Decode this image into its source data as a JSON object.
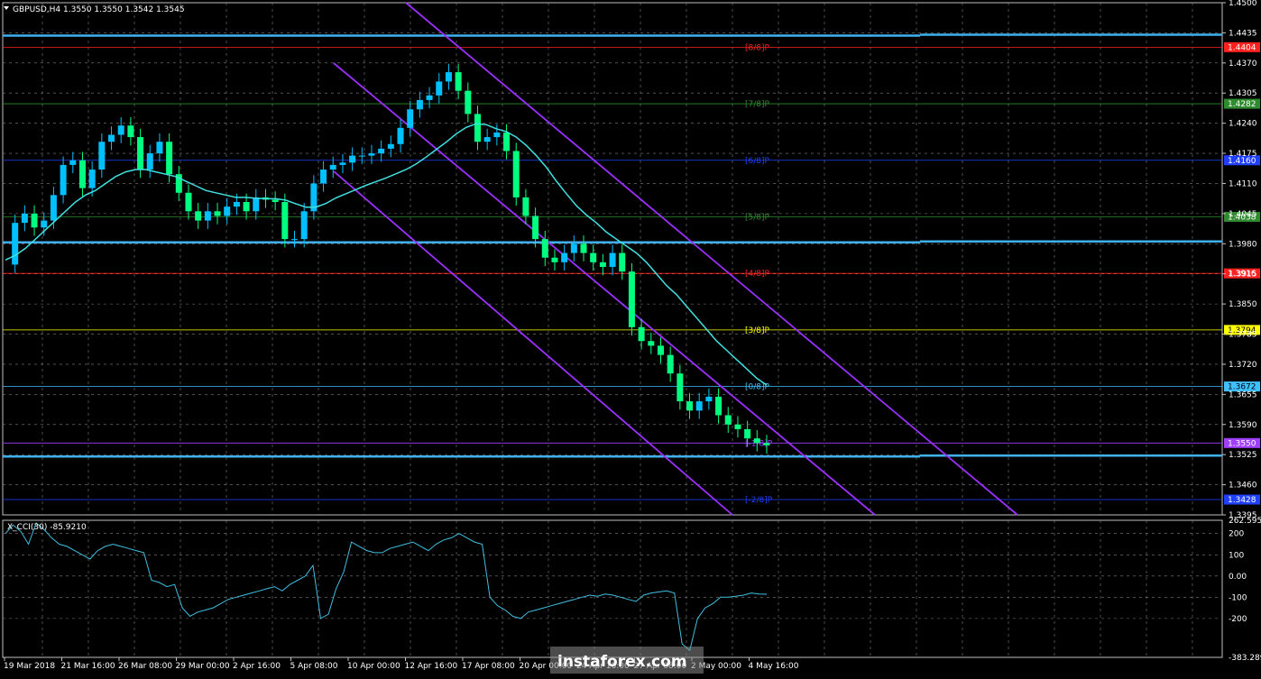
{
  "chart_data": {
    "type": "candlestick",
    "symbol_header": "GBPUSD,H4  1.3550 1.3550 1.3542 1.3545",
    "price_axis": {
      "min": 1.3395,
      "max": 1.45,
      "tick_labels": [
        "1.4500",
        "1.4435",
        "1.4370",
        "1.4305",
        "1.4240",
        "1.4175",
        "1.4110",
        "1.4045",
        "1.3980",
        "1.3915",
        "1.3850",
        "1.3785",
        "1.3720",
        "1.3655",
        "1.3590",
        "1.3525",
        "1.3460",
        "1.3395"
      ]
    },
    "time_axis": {
      "labels": [
        "19 Mar 2018",
        "21 Mar 16:00",
        "26 Mar 08:00",
        "29 Mar 00:00",
        "2 Apr 16:00",
        "5 Apr 08:00",
        "10 Apr 00:00",
        "12 Apr 16:00",
        "17 Apr 08:00",
        "20 Apr 00:00",
        "24 Apr 16:00",
        "27 Apr 08:00",
        "2 May 00:00",
        "4 May 16:00"
      ]
    },
    "close_series": [
      1.3935,
      1.4025,
      1.4045,
      1.4015,
      1.403,
      1.4085,
      1.415,
      1.416,
      1.41,
      1.414,
      1.42,
      1.4215,
      1.4235,
      1.421,
      1.414,
      1.4175,
      1.42,
      1.413,
      1.409,
      1.405,
      1.403,
      1.405,
      1.404,
      1.406,
      1.407,
      1.405,
      1.408,
      1.4075,
      1.407,
      1.399,
      1.399,
      1.405,
      1.411,
      1.414,
      1.415,
      1.4155,
      1.417,
      1.417,
      1.4175,
      1.4185,
      1.4195,
      1.423,
      1.427,
      1.429,
      1.43,
      1.433,
      1.435,
      1.431,
      1.426,
      1.42,
      1.421,
      1.422,
      1.418,
      1.408,
      1.404,
      1.399,
      1.395,
      1.394,
      1.396,
      1.398,
      1.396,
      1.394,
      1.393,
      1.396,
      1.392,
      1.38,
      1.377,
      1.376,
      1.374,
      1.37,
      1.364,
      1.362,
      1.364,
      1.365,
      1.361,
      1.359,
      1.358,
      1.356,
      1.355,
      1.3545
    ],
    "moving_average_series": [
      1.3945,
      1.3955,
      1.397,
      1.399,
      1.401,
      1.403,
      1.405,
      1.407,
      1.4085,
      1.4095,
      1.411,
      1.4125,
      1.4135,
      1.414,
      1.414,
      1.4135,
      1.413,
      1.4125,
      1.4115,
      1.4105,
      1.4095,
      1.409,
      1.4085,
      1.408,
      1.408,
      1.4078,
      1.4077,
      1.4077,
      1.4074,
      1.4066,
      1.4059,
      1.4059,
      1.4067,
      1.4079,
      1.4088,
      1.4097,
      1.4106,
      1.4114,
      1.4122,
      1.4131,
      1.414,
      1.4152,
      1.4167,
      1.4183,
      1.4199,
      1.4217,
      1.4231,
      1.4239,
      1.4237,
      1.4228,
      1.4222,
      1.421,
      1.4192,
      1.417,
      1.4145,
      1.4115,
      1.4088,
      1.4062,
      1.4042,
      1.4025,
      1.4005,
      1.399,
      1.3975,
      1.396,
      1.394,
      1.3915,
      1.389,
      1.387,
      1.3845,
      1.382,
      1.3795,
      1.377,
      1.375,
      1.373,
      1.371,
      1.369,
      1.3675
    ],
    "horizontal_levels": [
      {
        "label": "[8/8]P",
        "price_label": "1.4404",
        "price": 1.4404,
        "color": "#ff2020"
      },
      {
        "label": "[7/8]P",
        "price_label": "1.4282",
        "price": 1.4282,
        "color": "#2e8b2e"
      },
      {
        "label": "[6/8]P",
        "price_label": "1.4160",
        "price": 1.416,
        "color": "#2040ff"
      },
      {
        "label": "[5/8]P",
        "price_label": "1.4038",
        "price": 1.4038,
        "color": "#2e8b2e"
      },
      {
        "label": "[4/8]P",
        "price_label": "1.3916",
        "price": 1.3916,
        "color": "#ff2020"
      },
      {
        "label": "[3/8]P",
        "price_label": "1.3794",
        "price": 1.3794,
        "color": "#ffff00"
      },
      {
        "label": "[0/8]P",
        "price_label": "1.3672",
        "price": 1.3672,
        "color": "#40c0ff"
      },
      {
        "label": "[-1/8]P",
        "price_label": "1.3550",
        "price": 1.355,
        "color": "#a040ff"
      },
      {
        "label": "[-2/8]P",
        "price_label": "1.3428",
        "price": 1.3428,
        "color": "#2040ff"
      }
    ],
    "indicator": {
      "header": "X_CCI(30) -85.9210",
      "scale_labels": [
        "262.5955",
        "200",
        "100",
        "0.00",
        "-100",
        "-200",
        "-383.2898"
      ],
      "range": [
        -383.29,
        262.6
      ],
      "values": [
        200,
        240,
        210,
        150,
        250,
        220,
        180,
        150,
        140,
        120,
        100,
        80,
        120,
        140,
        150,
        140,
        130,
        120,
        110,
        -20,
        -30,
        -50,
        -40,
        -150,
        -190,
        -170,
        -160,
        -150,
        -130,
        -110,
        -100,
        -90,
        -80,
        -70,
        -60,
        -50,
        -70,
        -40,
        -20,
        0,
        50,
        -200,
        -180,
        -60,
        20,
        160,
        140,
        120,
        110,
        110,
        130,
        140,
        150,
        160,
        140,
        120,
        150,
        170,
        180,
        200,
        180,
        160,
        150,
        -100,
        -140,
        -160,
        -190,
        -200,
        -170,
        -160,
        -150,
        -140,
        -130,
        -120,
        -110,
        -100,
        -90,
        -95,
        -85,
        -90,
        -100,
        -110,
        -120,
        -90,
        -80,
        -75,
        -70,
        -80,
        -320,
        -350,
        -200,
        -150,
        -130,
        -100,
        -100,
        -95,
        -90,
        -80,
        -85,
        -86
      ]
    }
  },
  "watermark": "instaforex.com",
  "colors": {
    "background": "#000000",
    "grid": "#808080",
    "bull": "#00c0ff",
    "bear": "#00ff80",
    "ma": "#40e0e0",
    "channel": "#9b30ff",
    "support": "#40b0f0",
    "cci": "#40c0e0"
  }
}
